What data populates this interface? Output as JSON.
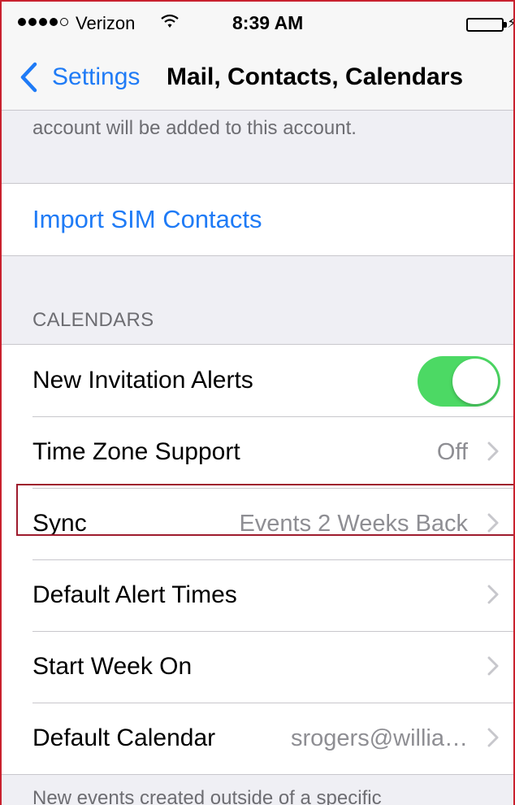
{
  "status_bar": {
    "carrier": "Verizon",
    "time": "8:39 AM",
    "signal_bars_filled": 4,
    "signal_bars_total": 5,
    "icons": [
      "signal-dots-icon",
      "wifi-icon",
      "battery-icon",
      "charging-icon"
    ]
  },
  "nav": {
    "back_label": "Settings",
    "title": "Mail, Contacts, Calendars",
    "back_icon": "chevron-left-icon"
  },
  "contacts_section": {
    "footer_text": "account will be added to this account.",
    "import_label": "Import SIM Contacts"
  },
  "calendars_section": {
    "header": "CALENDARS",
    "rows": [
      {
        "label": "New Invitation Alerts",
        "toggle_on": true
      },
      {
        "label": "Time Zone Support",
        "value": "Off"
      },
      {
        "label": "Sync",
        "value": "Events 2 Weeks Back"
      },
      {
        "label": "Default Alert Times",
        "value": ""
      },
      {
        "label": "Start Week On",
        "value": ""
      },
      {
        "label": "Default Calendar",
        "value": "srogers@willia…"
      }
    ],
    "footer_text": "New events created outside of a specific"
  },
  "colors": {
    "accent": "#1f7bf6",
    "toggle_on": "#4cd964",
    "background": "#efeff4",
    "highlight_border": "#9e1b2d"
  }
}
